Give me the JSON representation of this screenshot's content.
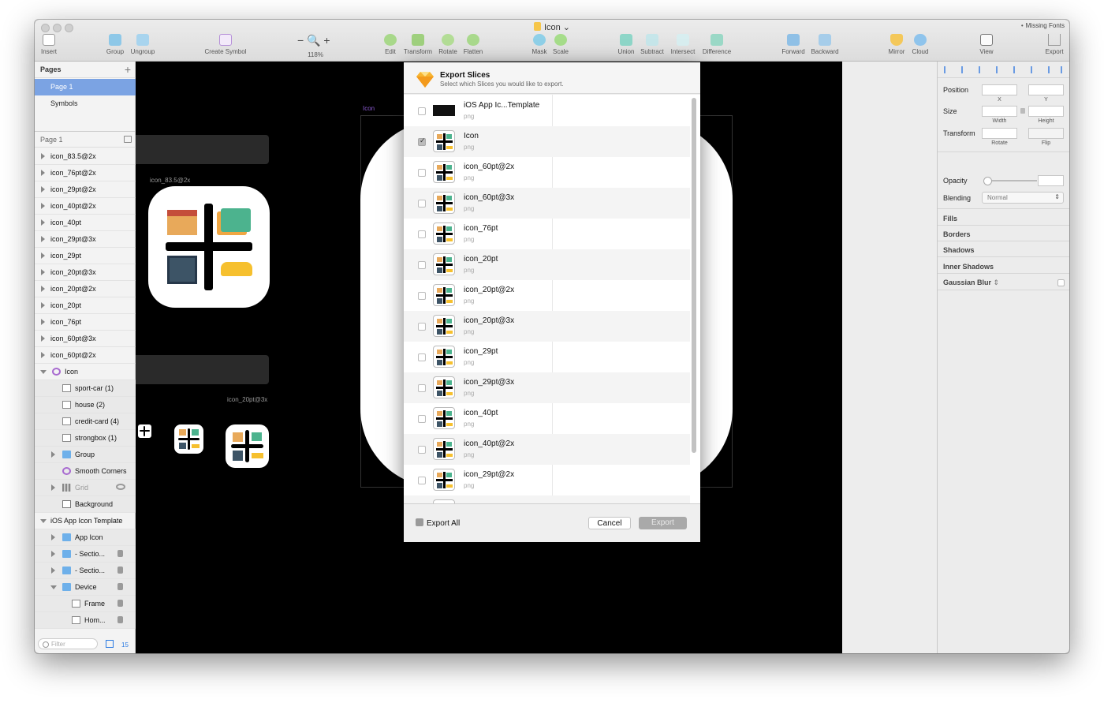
{
  "window": {
    "title": "Icon",
    "missing_fonts": "Missing Fonts"
  },
  "toolbar": {
    "insert": "Insert",
    "group": "Group",
    "ungroup": "Ungroup",
    "create_symbol": "Create Symbol",
    "zoom_value": "118%",
    "edit": "Edit",
    "transform": "Transform",
    "rotate": "Rotate",
    "flatten": "Flatten",
    "mask": "Mask",
    "scale": "Scale",
    "union": "Union",
    "subtract": "Subtract",
    "intersect": "Intersect",
    "difference": "Difference",
    "forward": "Forward",
    "backward": "Backward",
    "mirror": "Mirror",
    "cloud": "Cloud",
    "view": "View",
    "export": "Export"
  },
  "pages": {
    "header": "Pages",
    "items": [
      "Page 1",
      "Symbols"
    ]
  },
  "layers": {
    "header": "Page 1",
    "items": [
      "icon_83.5@2x",
      "icon_76pt@2x",
      "icon_29pt@2x",
      "icon_40pt@2x",
      "icon_40pt",
      "icon_29pt@3x",
      "icon_29pt",
      "icon_20pt@3x",
      "icon_20pt@2x",
      "icon_20pt",
      "icon_76pt",
      "icon_60pt@3x",
      "icon_60pt@2x",
      "Icon",
      "sport-car (1)",
      "house (2)",
      "credit-card (4)",
      "strongbox (1)",
      "Group",
      "Smooth Corners",
      "Grid",
      "Background",
      "iOS App Icon Template",
      "App Icon",
      "- Sectio...",
      "- Sectio...",
      "Device",
      "Frame",
      "Hom..."
    ],
    "filter_placeholder": "Filter",
    "count": "15"
  },
  "canvas": {
    "label_83": "icon_83.5@2x",
    "label_20_3x": "icon_20pt@3x",
    "label_icon": "Icon"
  },
  "inspector": {
    "position": "Position",
    "x": "X",
    "y": "Y",
    "size": "Size",
    "width": "Width",
    "height": "Height",
    "transform": "Transform",
    "rotate": "Rotate",
    "flip": "Flip",
    "opacity": "Opacity",
    "blending": "Blending",
    "blending_value": "Normal",
    "fills": "Fills",
    "borders": "Borders",
    "shadows": "Shadows",
    "inner_shadows": "Inner Shadows",
    "gaussian_blur": "Gaussian Blur"
  },
  "dialog": {
    "title": "Export Slices",
    "subtitle": "Select which Slices you would like to export.",
    "slices": [
      {
        "name": "iOS App Ic...Template",
        "format": "png",
        "checked": false
      },
      {
        "name": "Icon",
        "format": "png",
        "checked": true
      },
      {
        "name": "icon_60pt@2x",
        "format": "png",
        "checked": false
      },
      {
        "name": "icon_60pt@3x",
        "format": "png",
        "checked": false
      },
      {
        "name": "icon_76pt",
        "format": "png",
        "checked": false
      },
      {
        "name": "icon_20pt",
        "format": "png",
        "checked": false
      },
      {
        "name": "icon_20pt@2x",
        "format": "png",
        "checked": false
      },
      {
        "name": "icon_20pt@3x",
        "format": "png",
        "checked": false
      },
      {
        "name": "icon_29pt",
        "format": "png",
        "checked": false
      },
      {
        "name": "icon_29pt@3x",
        "format": "png",
        "checked": false
      },
      {
        "name": "icon_40pt",
        "format": "png",
        "checked": false
      },
      {
        "name": "icon_40pt@2x",
        "format": "png",
        "checked": false
      },
      {
        "name": "icon_29pt@2x",
        "format": "png",
        "checked": false
      }
    ],
    "export_all": "Export All",
    "cancel": "Cancel",
    "export": "Export"
  }
}
